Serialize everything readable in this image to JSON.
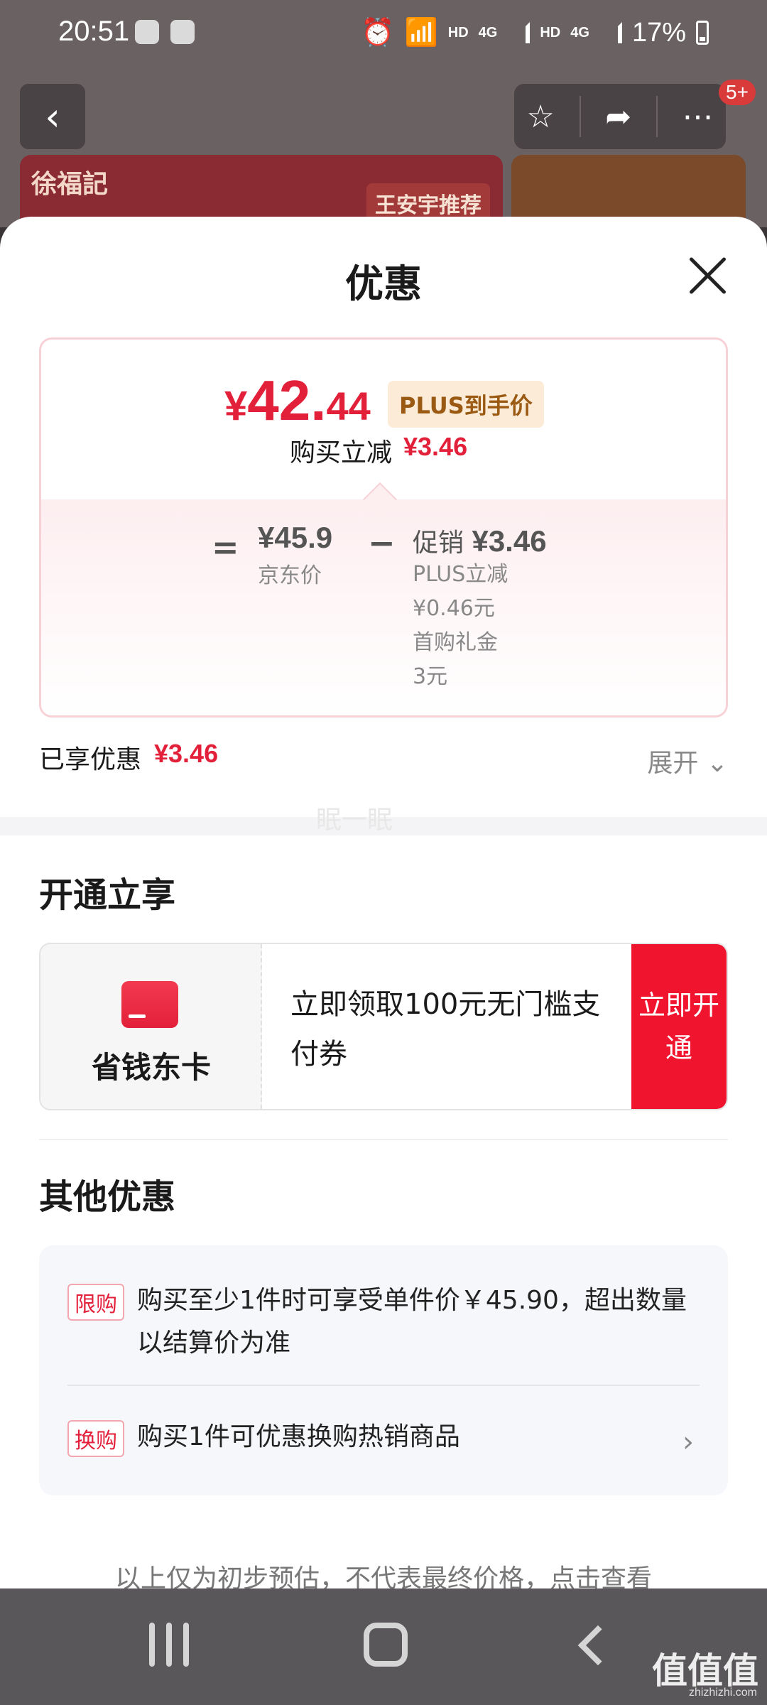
{
  "status_bar": {
    "time": "20:51",
    "network_labels": [
      "HD",
      "4G",
      "HD",
      "4G"
    ],
    "battery": "17%"
  },
  "background_page": {
    "banner_brand": "徐福記",
    "banner_tag": "王安宇推荐",
    "cart_badge": "5+",
    "icons": [
      "back-icon",
      "star-icon",
      "share-icon",
      "more-icon"
    ]
  },
  "sheet": {
    "title": "优惠",
    "price_card": {
      "currency": "¥",
      "price_int": "42.",
      "price_dec": "44",
      "plus_tag": "PLUS到手价",
      "reduce_label": "购买立减",
      "reduce_amount": "¥3.46",
      "equals": "=",
      "jd_price": "¥45.9",
      "jd_price_label": "京东价",
      "minus": "−",
      "promo_label": "促销",
      "promo_amount": "¥3.46",
      "promo_details": [
        "PLUS立减",
        "¥0.46元",
        "首购礼金",
        "3元"
      ]
    },
    "enjoyed_label": "已享优惠",
    "enjoyed_amount": "¥3.46",
    "expand_label": "展开",
    "watermark": "眠一眠",
    "open_section": {
      "title": "开通立享",
      "card_name": "省钱东卡",
      "description": "立即领取100元无门槛支付券",
      "button": "立即开通"
    },
    "other_section": {
      "title": "其他优惠",
      "items": [
        {
          "tag": "限购",
          "text": "购买至少1件时可享受单件价￥45.90，超出数量以结算价为准"
        },
        {
          "tag": "换购",
          "text": "购买1件可优惠换购热销商品"
        }
      ]
    },
    "footnote": "以上仅为初步预估，不代表最终价格，点击查看"
  },
  "watermark_site": {
    "logo": "值值值",
    "url": "zhizhizhi.com"
  }
}
